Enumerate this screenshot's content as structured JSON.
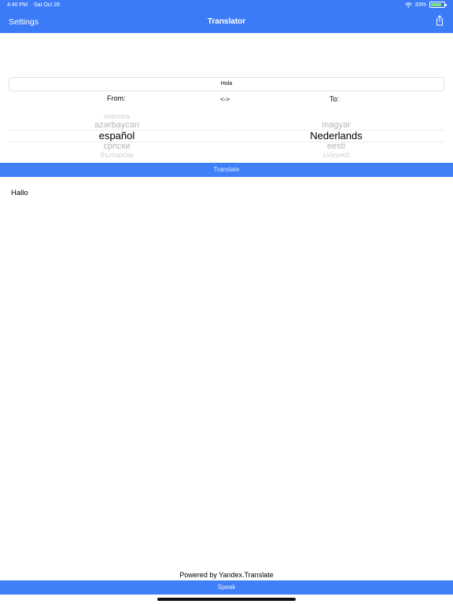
{
  "status_bar": {
    "time": "4:40 PM",
    "date": "Sat Oct 26",
    "battery": "83%",
    "battery_level": 0.83
  },
  "nav": {
    "settings_label": "Settings",
    "title": "Translator"
  },
  "input": {
    "value": "Hola"
  },
  "labels": {
    "from": "From:",
    "swap": "<->",
    "to": "To:"
  },
  "from_picker": {
    "above_far": "íslenska",
    "above": "azərbaycan",
    "selected": "español",
    "below": "српски",
    "below_far": "български"
  },
  "to_picker": {
    "above": "magyar",
    "selected": "Nederlands",
    "below": "eesti",
    "below_far": "ελληνικά"
  },
  "translate_label": "Translate",
  "output": "Hallo",
  "footer": {
    "powered_by": "Powered by Yandex.Translate",
    "speak_label": "Speak"
  },
  "colors": {
    "accent": "#3b7bf7",
    "button": "#3f80f8"
  }
}
